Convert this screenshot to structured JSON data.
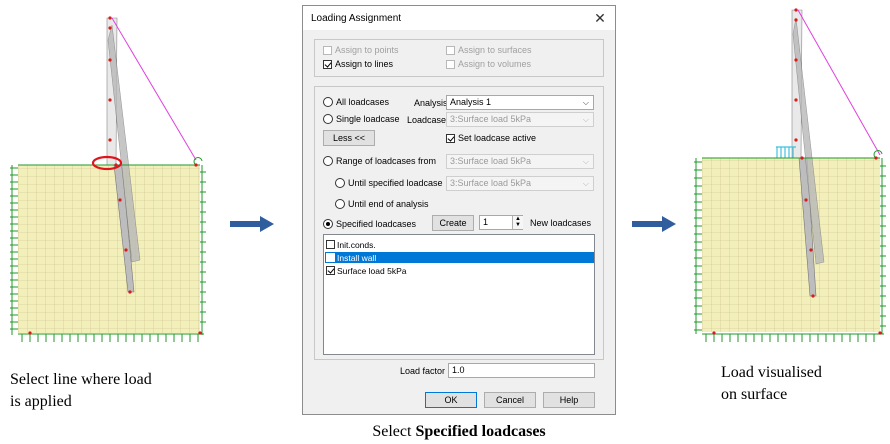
{
  "captions": {
    "left_line1": "Select line where load",
    "left_line2": "is applied",
    "center_prefix": "Select ",
    "center_bold": "Specified loadcases",
    "right_line1": "Load visualised",
    "right_line2": "on surface"
  },
  "dialog": {
    "title": "Loading Assignment",
    "assign": {
      "points": {
        "label": "Assign to points",
        "checked": false,
        "enabled": false
      },
      "lines": {
        "label": "Assign to lines",
        "checked": true,
        "enabled": true
      },
      "surfaces": {
        "label": "Assign to surfaces",
        "checked": false,
        "enabled": false
      },
      "volumes": {
        "label": "Assign to volumes",
        "checked": false,
        "enabled": false
      }
    },
    "all_loadcases": "All loadcases",
    "analysis_label": "Analysis",
    "analysis_value": "Analysis 1",
    "single_loadcase": "Single loadcase",
    "loadcase_label": "Loadcase",
    "loadcase_value": "3:Surface load 5kPa",
    "less_button": "Less <<",
    "set_active": "Set loadcase active",
    "range_from": "Range of loadcases from",
    "range_from_value": "3:Surface load 5kPa",
    "until_specified": "Until specified loadcase",
    "until_specified_value": "3:Surface load 5kPa",
    "until_end": "Until end of analysis",
    "specified_loadcases": "Specified loadcases",
    "create_button": "Create",
    "create_count": "1",
    "new_loadcases": "New loadcases",
    "list_items": [
      {
        "label": "Init.conds.",
        "checked": false,
        "selected": false
      },
      {
        "label": "Install wall",
        "checked": false,
        "selected": true
      },
      {
        "label": "Surface load 5kPa",
        "checked": true,
        "selected": false
      }
    ],
    "load_factor_label": "Load factor",
    "load_factor_value": "1.0",
    "ok_button": "OK",
    "cancel_button": "Cancel",
    "help_button": "Help"
  },
  "colors": {
    "mesh_fill": "#f3efbb",
    "mesh_line": "#c9c08a",
    "support_green": "#1f9a2a",
    "wall_gray": "#a8a8a8",
    "node_red": "#d81c1c",
    "anchor_magenta": "#e040e0",
    "arrow_blue": "#2f5d9e",
    "load_cyan": "#3fc0e0",
    "select_blue": "#0078d7"
  }
}
